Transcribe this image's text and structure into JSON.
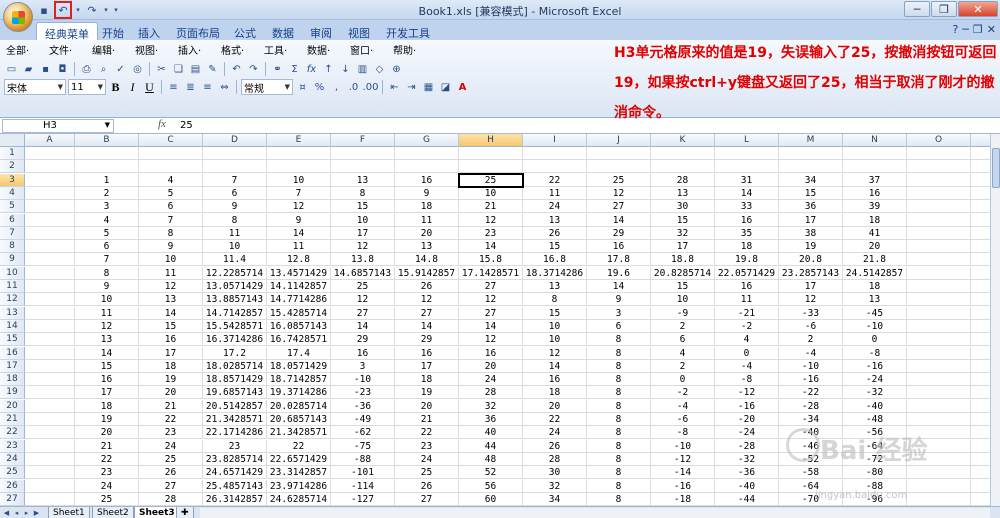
{
  "window": {
    "title": "Book1.xls  [兼容模式] - Microsoft Excel"
  },
  "quick_access": {
    "save_icon": "save-icon",
    "undo_icon": "undo-icon",
    "redo_icon": "redo-icon"
  },
  "ribbon_tabs": [
    "经典菜单",
    "开始",
    "插入",
    "页面布局",
    "公式",
    "数据",
    "审阅",
    "视图",
    "开发工具"
  ],
  "menu": [
    "全部·",
    "文件·",
    "编辑·",
    "视图·",
    "插入·",
    "格式·",
    "工具·",
    "数据·",
    "窗口·",
    "帮助·"
  ],
  "font": {
    "name": "宋体",
    "size": "11",
    "number_format": "常规"
  },
  "annotation": "H3单元格原来的值是19，失误输入了25，按撤消按钮可返回19，如果按ctrl+y键盘又返回了25，相当于取消了刚才的撤消命令。",
  "formula_bar": {
    "name_box": "H3",
    "fx": "fx",
    "value": "25"
  },
  "columns": [
    "A",
    "B",
    "C",
    "D",
    "E",
    "F",
    "G",
    "H",
    "I",
    "J",
    "K",
    "L",
    "M",
    "N",
    "O",
    "P"
  ],
  "rows": [
    [
      "",
      "",
      "",
      "",
      "",
      "",
      "",
      "",
      "",
      "",
      "",
      "",
      "",
      ""
    ],
    [
      "",
      "",
      "",
      "",
      "",
      "",
      "",
      "",
      "",
      "",
      "",
      "",
      "",
      ""
    ],
    [
      "",
      "1",
      "4",
      "7",
      "10",
      "13",
      "16",
      "25",
      "22",
      "25",
      "28",
      "31",
      "34",
      "37"
    ],
    [
      "",
      "2",
      "5",
      "6",
      "7",
      "8",
      "9",
      "10",
      "11",
      "12",
      "13",
      "14",
      "15",
      "16"
    ],
    [
      "",
      "3",
      "6",
      "9",
      "12",
      "15",
      "18",
      "21",
      "24",
      "27",
      "30",
      "33",
      "36",
      "39"
    ],
    [
      "",
      "4",
      "7",
      "8",
      "9",
      "10",
      "11",
      "12",
      "13",
      "14",
      "15",
      "16",
      "17",
      "18"
    ],
    [
      "",
      "5",
      "8",
      "11",
      "14",
      "17",
      "20",
      "23",
      "26",
      "29",
      "32",
      "35",
      "38",
      "41"
    ],
    [
      "",
      "6",
      "9",
      "10",
      "11",
      "12",
      "13",
      "14",
      "15",
      "16",
      "17",
      "18",
      "19",
      "20"
    ],
    [
      "",
      "7",
      "10",
      "11.4",
      "12.8",
      "13.8",
      "14.8",
      "15.8",
      "16.8",
      "17.8",
      "18.8",
      "19.8",
      "20.8",
      "21.8"
    ],
    [
      "",
      "8",
      "11",
      "12.2285714",
      "13.4571429",
      "14.6857143",
      "15.9142857",
      "17.1428571",
      "18.3714286",
      "19.6",
      "20.8285714",
      "22.0571429",
      "23.2857143",
      "24.5142857"
    ],
    [
      "",
      "9",
      "12",
      "13.0571429",
      "14.1142857",
      "25",
      "26",
      "27",
      "13",
      "14",
      "15",
      "16",
      "17",
      "18"
    ],
    [
      "",
      "10",
      "13",
      "13.8857143",
      "14.7714286",
      "12",
      "12",
      "12",
      "8",
      "9",
      "10",
      "11",
      "12",
      "13"
    ],
    [
      "",
      "11",
      "14",
      "14.7142857",
      "15.4285714",
      "27",
      "27",
      "27",
      "15",
      "3",
      "-9",
      "-21",
      "-33",
      "-45"
    ],
    [
      "",
      "12",
      "15",
      "15.5428571",
      "16.0857143",
      "14",
      "14",
      "14",
      "10",
      "6",
      "2",
      "-2",
      "-6",
      "-10"
    ],
    [
      "",
      "13",
      "16",
      "16.3714286",
      "16.7428571",
      "29",
      "29",
      "12",
      "10",
      "8",
      "6",
      "4",
      "2",
      "0"
    ],
    [
      "",
      "14",
      "17",
      "17.2",
      "17.4",
      "16",
      "16",
      "16",
      "12",
      "8",
      "4",
      "0",
      "-4",
      "-8"
    ],
    [
      "",
      "15",
      "18",
      "18.0285714",
      "18.0571429",
      "3",
      "17",
      "20",
      "14",
      "8",
      "2",
      "-4",
      "-10",
      "-16"
    ],
    [
      "",
      "16",
      "19",
      "18.8571429",
      "18.7142857",
      "-10",
      "18",
      "24",
      "16",
      "8",
      "0",
      "-8",
      "-16",
      "-24"
    ],
    [
      "",
      "17",
      "20",
      "19.6857143",
      "19.3714286",
      "-23",
      "19",
      "28",
      "18",
      "8",
      "-2",
      "-12",
      "-22",
      "-32"
    ],
    [
      "",
      "18",
      "21",
      "20.5142857",
      "20.0285714",
      "-36",
      "20",
      "32",
      "20",
      "8",
      "-4",
      "-16",
      "-28",
      "-40"
    ],
    [
      "",
      "19",
      "22",
      "21.3428571",
      "20.6857143",
      "-49",
      "21",
      "36",
      "22",
      "8",
      "-6",
      "-20",
      "-34",
      "-48"
    ],
    [
      "",
      "20",
      "23",
      "22.1714286",
      "21.3428571",
      "-62",
      "22",
      "40",
      "24",
      "8",
      "-8",
      "-24",
      "-40",
      "-56"
    ],
    [
      "",
      "21",
      "24",
      "23",
      "22",
      "-75",
      "23",
      "44",
      "26",
      "8",
      "-10",
      "-28",
      "-46",
      "-64"
    ],
    [
      "",
      "22",
      "25",
      "23.8285714",
      "22.6571429",
      "-88",
      "24",
      "48",
      "28",
      "8",
      "-12",
      "-32",
      "-52",
      "-72"
    ],
    [
      "",
      "23",
      "26",
      "24.6571429",
      "23.3142857",
      "-101",
      "25",
      "52",
      "30",
      "8",
      "-14",
      "-36",
      "-58",
      "-80"
    ],
    [
      "",
      "24",
      "27",
      "25.4857143",
      "23.9714286",
      "-114",
      "26",
      "56",
      "32",
      "8",
      "-16",
      "-40",
      "-64",
      "-88"
    ],
    [
      "",
      "25",
      "28",
      "26.3142857",
      "24.6285714",
      "-127",
      "27",
      "60",
      "34",
      "8",
      "-18",
      "-44",
      "-70",
      "-96"
    ]
  ],
  "sheets": [
    "Sheet1",
    "Sheet2",
    "Sheet3"
  ],
  "watermark": {
    "text": "Bai 经验",
    "url": "jingyan.baidu.com"
  }
}
